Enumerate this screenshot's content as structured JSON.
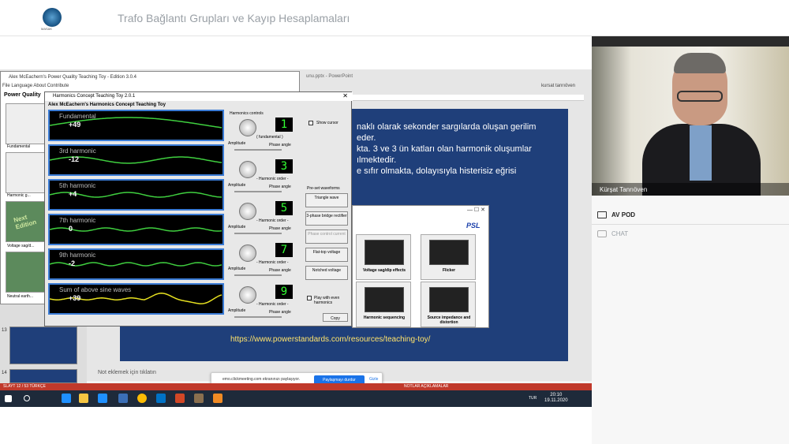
{
  "header": {
    "page_title": "Trafo Bağlantı Grupları ve Kayıp Hesaplamaları",
    "logo_caption": "MASAK"
  },
  "powerpoint": {
    "title_fragment": "unu.pptx - PowerPoint",
    "user": "kursat tanrıöven",
    "slide_lines": [
      "naklı olarak sekonder sargılarda oluşan gerilim",
      "eder.",
      "kta. 3 ve 3 ün katları olan harmonik oluşumlar",
      "ılmektedir.",
      "e sıfır olmakta, dolayısıyla histerisiz eğrisi"
    ],
    "slide_url": "https://www.powerstandards.com/resources/teaching-toy/",
    "notes_placeholder": "Not eklemek için tıklatın",
    "slide_numbers": [
      "13",
      "14"
    ],
    "status_left": "SLAYT 12 / 53    TÜRKÇE",
    "status_right": "NOTLAR    AÇIKLAMALAR"
  },
  "pq_window": {
    "title": "Alex McEachern's Power Quality Teaching Toy - Edition 3.0.4",
    "menu": "File   Language   About   Contribute",
    "heading": "Power Quality",
    "cards": [
      "Fundamental",
      "Harmonic g...",
      "Voltage sag/d...",
      "Neutral earth..."
    ],
    "next_edition": "Next Edition"
  },
  "harmonics_window": {
    "title": "Harmonics Concept Teaching Toy   2.0.1",
    "subtitle": "Alex McEachern's  Harmonics Concept Teaching Toy",
    "waves": [
      {
        "label": "Fundamental",
        "value": "+49",
        "color": "#3fcf3f"
      },
      {
        "label": "3rd harmonic",
        "value": "-12",
        "color": "#3fcf3f"
      },
      {
        "label": "5th harmonic",
        "value": "+4",
        "color": "#3fcf3f"
      },
      {
        "label": "7th harmonic",
        "value": "0",
        "color": "#3fcf3f"
      },
      {
        "label": "9th harmonic",
        "value": "-2",
        "color": "#3fcf3f"
      },
      {
        "label": "Sum of above sine waves",
        "value": "+39",
        "color": "#e6e020"
      }
    ],
    "controls_title": "Harmonics controls",
    "orders": [
      "1",
      "3",
      "5",
      "7",
      "9"
    ],
    "fundamental_label": "( fundamental )",
    "order_label": "- Harmonic order -",
    "phase_label": "Phase angle",
    "amplitude_label": "Amplitude",
    "show_cursor": "Show cursor",
    "preset_title": "Pre-set waveforms",
    "presets": [
      "Triangle wave",
      "3-phase bridge rectifier",
      "Phase control current",
      "Flat-top voltage",
      "Notched voltage"
    ],
    "play_even": "Play with even harmonics",
    "copy": "Copy"
  },
  "psl_window": {
    "logo": "PSL",
    "cards": [
      "Voltage sag/dip effects",
      "Flicker",
      "Harmonic sequencing",
      "Source impedance and distortion"
    ]
  },
  "share_bar": {
    "text": "emo.clickmeeting.com ekranınızı paylaşıyor.",
    "stop": "Paylaşmayı durdur",
    "hide": "Gizle"
  },
  "taskbar": {
    "time": "20:10",
    "date": "19.11.2020",
    "lang": "TUR"
  },
  "video": {
    "presenter": "Kürşat Tanrıöven"
  },
  "sidepanel": {
    "av_pod": "AV POD",
    "chat": "CHAT"
  },
  "colors": {
    "slide_bg": "#1f3f7a",
    "accent_blue": "#1a73e8",
    "status_red": "#c0392b"
  }
}
